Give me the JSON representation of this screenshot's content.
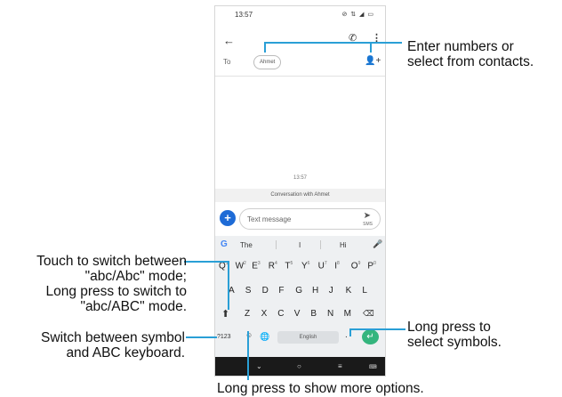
{
  "status_bar": {
    "time": "13:57",
    "icons": "⊘ ⇅ ◢ ▭"
  },
  "header": {
    "back_icon": "arrow-left-icon",
    "call_icon": "phone-icon",
    "more_icon": "more-vert-icon",
    "to_label": "To",
    "recipient": "Ahmet",
    "add_contact_icon": "add-contact-icon"
  },
  "conversation": {
    "timestamp": "13:57",
    "banner": "Conversation with Ahmet"
  },
  "compose": {
    "placeholder": "Text message",
    "send_label": "SMS"
  },
  "keyboard": {
    "suggestions": [
      "The",
      "I",
      "Hi"
    ],
    "row1": [
      {
        "k": "Q",
        "h": "1"
      },
      {
        "k": "W",
        "h": "2"
      },
      {
        "k": "E",
        "h": "3"
      },
      {
        "k": "R",
        "h": "4"
      },
      {
        "k": "T",
        "h": "5"
      },
      {
        "k": "Y",
        "h": "6"
      },
      {
        "k": "U",
        "h": "7"
      },
      {
        "k": "I",
        "h": "8"
      },
      {
        "k": "O",
        "h": "9"
      },
      {
        "k": "P",
        "h": "0"
      }
    ],
    "row2": [
      "A",
      "S",
      "D",
      "F",
      "G",
      "H",
      "J",
      "K",
      "L"
    ],
    "row3": [
      "Z",
      "X",
      "C",
      "V",
      "B",
      "N",
      "M"
    ],
    "symbol_key": "?123",
    "space_label": "English"
  },
  "callouts": {
    "contacts": "Enter numbers or\nselect from contacts.",
    "shift": "Touch to switch between\n\"abc/Abc\" mode;\nLong press to switch to\n\"abc/ABC\" mode.",
    "symbols_switch": "Switch between symbol\nand ABC keyboard.",
    "long_press_symbols": "Long press to\nselect symbols.",
    "long_press_options": "Long press to show more options."
  },
  "colors": {
    "callout_line": "#2a9fd6",
    "send_fab": "#1e6bd6",
    "enter_key": "#34b57e"
  }
}
